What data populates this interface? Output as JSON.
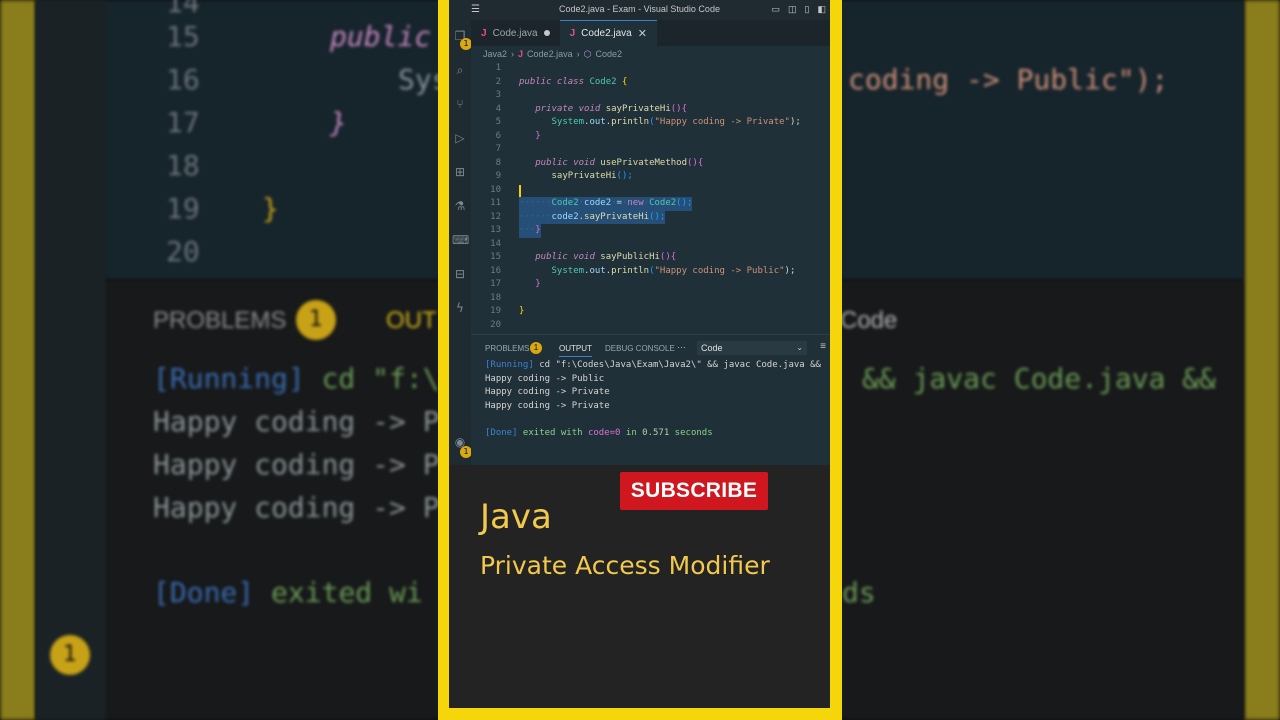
{
  "window": {
    "title": "Code2.java - Exam - Visual Studio Code"
  },
  "tabs": [
    {
      "label": "Code.java",
      "modified": true
    },
    {
      "label": "Code2.java",
      "active": true
    }
  ],
  "breadcrumb": {
    "folder": "Java2",
    "file": "Code2.java",
    "symbol": "Code2"
  },
  "activity_badges": {
    "explorer": "1",
    "accounts": "1"
  },
  "editor": {
    "line_numbers": [
      "1",
      "2",
      "3",
      "4",
      "5",
      "6",
      "7",
      "8",
      "9",
      "10",
      "11",
      "12",
      "13",
      "14",
      "15",
      "16",
      "17",
      "18",
      "19",
      "20"
    ],
    "l2": {
      "kw": "public class",
      "cls": "Code2",
      "brace": "{"
    },
    "l4": {
      "kw": "private void",
      "fn": "sayPrivateHi",
      "paren": "()",
      "brace": "{"
    },
    "l5": {
      "obj": "System",
      "dot1": ".",
      "out": "out",
      "dot2": ".",
      "fn": "println",
      "open": "(",
      "str": "\"Happy coding -> Private\"",
      "close": ");"
    },
    "l6": {
      "brace": "}"
    },
    "l8": {
      "kw": "public void",
      "fn": "usePrivateMethod",
      "paren": "()",
      "brace": "{"
    },
    "l9": {
      "fn": "sayPrivateHi",
      "paren": "();"
    },
    "l11": {
      "cls": "Code2",
      "var": "code2",
      "eq": "=",
      "kw": "new",
      "cls2": "Code2",
      "paren": "();"
    },
    "l12": {
      "var": "code2",
      "dot": ".",
      "fn": "sayPrivateHi",
      "paren": "();"
    },
    "l13": {
      "brace": "}"
    },
    "l15": {
      "kw": "public void",
      "fn": "sayPublicHi",
      "paren": "()",
      "brace": "{"
    },
    "l16": {
      "obj": "System",
      "dot1": ".",
      "out": "out",
      "dot2": ".",
      "fn": "println",
      "open": "(",
      "str": "\"Happy coding -> Public\"",
      "close": ");"
    },
    "l17": {
      "brace": "}"
    },
    "l19": {
      "brace": "}"
    }
  },
  "panel": {
    "tabs": {
      "problems": "PROBLEMS",
      "problems_count": "1",
      "output": "OUTPUT",
      "debug": "DEBUG CONSOLE",
      "more": "···"
    },
    "select_value": "Code",
    "output": {
      "running_tag": "[Running]",
      "command": " cd \"f:\\Codes\\Java\\Exam\\Java2\\\" && javac Code.java &&",
      "line1": "Happy coding -> Public",
      "line2": "Happy coding -> Private",
      "line3": "Happy coding -> Private",
      "done_tag": "[Done]",
      "done_text": " exited with ",
      "code_label": "code=0",
      "in_text": " in ",
      "time": "0.571",
      "seconds": " seconds"
    }
  },
  "promo": {
    "subscribe": "SUBSCRIBE",
    "title": "Java",
    "subtitle": "Private Access Modifier"
  },
  "background": {
    "lines": [
      "14",
      "15",
      "16",
      "17",
      "18",
      "19",
      "20"
    ],
    "public_kw": "public",
    "sys_text": "Sys",
    "coding_public": "coding -> Public\");",
    "brace_inner": "}",
    "brace_outer": "}",
    "problems": "PROBLEMS",
    "problems_badge": "1",
    "output_partial": "OUT",
    "code_label": "Code",
    "running": "[Running]",
    "cd": " cd \"f:\\",
    "javac": "&& javac Code.java &&",
    "happy1": "Happy coding -> P",
    "happy2": "Happy coding -> P",
    "happy3": "Happy coding -> P",
    "done": "[Done]",
    "exited": " exited wi",
    "seconds_partial": "ds",
    "badge_bottom": "1"
  },
  "colors": {
    "frame": "#f5d60a",
    "subscribe_bg": "#d0171f",
    "promo_text": "#f2c94c",
    "editor_bg": "#203038"
  }
}
